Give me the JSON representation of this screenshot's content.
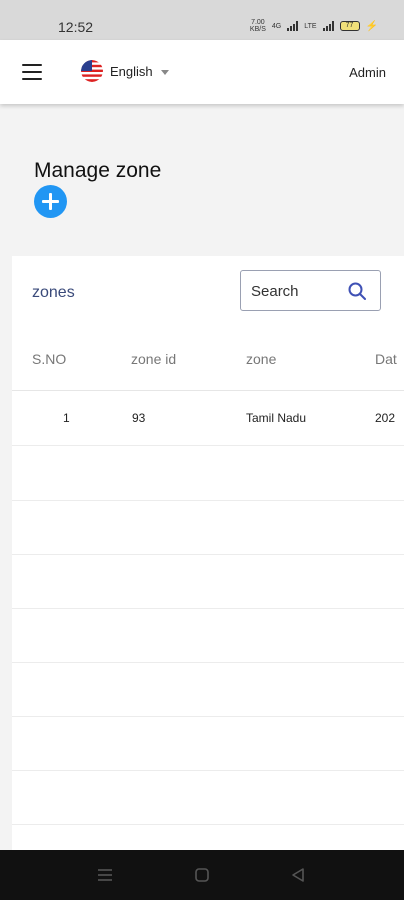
{
  "status_bar": {
    "time": "12:52",
    "net_speed_value": "7.00",
    "net_speed_unit": "KB/S",
    "signal_label_1": "4G",
    "signal_label_2": "LTE",
    "battery_level": "77"
  },
  "app_bar": {
    "language": "English",
    "user": "Admin"
  },
  "page": {
    "title": "Manage zone"
  },
  "table": {
    "title": "zones",
    "search_placeholder": "Search",
    "columns": [
      "S.NO",
      "zone id",
      "zone",
      "Dat"
    ],
    "rows": [
      {
        "sno": "1",
        "zone_id": "93",
        "zone": "Tamil Nadu",
        "date": "202"
      }
    ]
  },
  "colors": {
    "accent": "#2196f3",
    "card_title": "#3a4a7a",
    "nav_bar": "#111111"
  },
  "icons": [
    "menu-icon",
    "us-flag-icon",
    "chevron-down-icon",
    "add-icon",
    "search-icon",
    "recents-icon",
    "home-icon",
    "back-icon"
  ]
}
